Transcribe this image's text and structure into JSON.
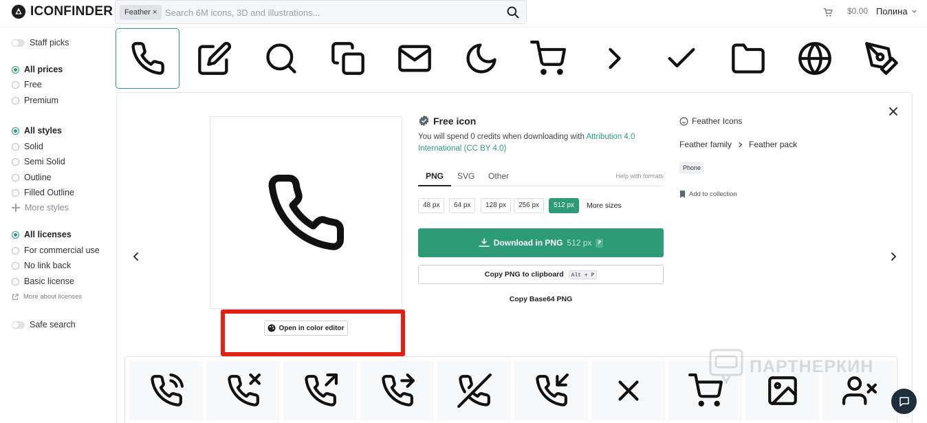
{
  "header": {
    "logo_text": "ICONFINDER",
    "search_tag": "Feather ×",
    "search_placeholder": "Search 6M icons, 3D and illustrations...",
    "price": "$0.00",
    "user": "Полина"
  },
  "sidebar": {
    "staff_picks": "Staff picks",
    "prices": [
      "All prices",
      "Free",
      "Premium"
    ],
    "styles": [
      "All styles",
      "Solid",
      "Semi Solid",
      "Outline",
      "Filled Outline"
    ],
    "more_styles": "More styles",
    "licenses": [
      "All licenses",
      "For commercial use",
      "No link back",
      "Basic license"
    ],
    "more_licenses": "More about licenses",
    "safe_search": "Safe search"
  },
  "top_strip_icons": [
    "phone-icon",
    "edit-icon",
    "search-icon",
    "copy-icon",
    "mail-icon",
    "moon-icon",
    "cart-icon",
    "chevron-right-icon",
    "check-icon",
    "folder-icon",
    "globe-icon",
    "pen-tool-icon"
  ],
  "detail": {
    "open_color_editor": "Open in color editor",
    "free_icon": "Free icon",
    "credits_text": "You will spend 0 credits when downloading with ",
    "license_link": "Attribution 4.0 International (CC BY 4.0)",
    "tabs": [
      "PNG",
      "SVG",
      "Other"
    ],
    "help_formats": "Help with formats",
    "sizes": [
      "48 px",
      "64 px",
      "128 px",
      "256 px",
      "512 px"
    ],
    "selected_size": "512 px",
    "more_sizes": "More sizes",
    "download_label": "Download in PNG",
    "download_size": "512 px",
    "download_key": "P",
    "copy_label": "Copy PNG to clipboard",
    "copy_key": "Alt + P",
    "copy_base64": "Copy Base64 PNG",
    "set_name": "Feather Icons",
    "family": "Feather family",
    "pack": "Feather pack",
    "tag": "Phone",
    "add_collection": "Add to collection"
  },
  "related_icons": [
    "phone-call-icon",
    "phone-missed-icon",
    "phone-outgoing-icon",
    "phone-forwarded-icon",
    "phone-off-icon",
    "phone-incoming-icon",
    "x-icon",
    "cart-icon",
    "image-icon",
    "user-x-icon"
  ],
  "watermark": "ПАРТНЕРКИН",
  "colors": {
    "accent": "#2c9b76",
    "highlight": "#e32012",
    "chat": "#1e2d3b"
  }
}
